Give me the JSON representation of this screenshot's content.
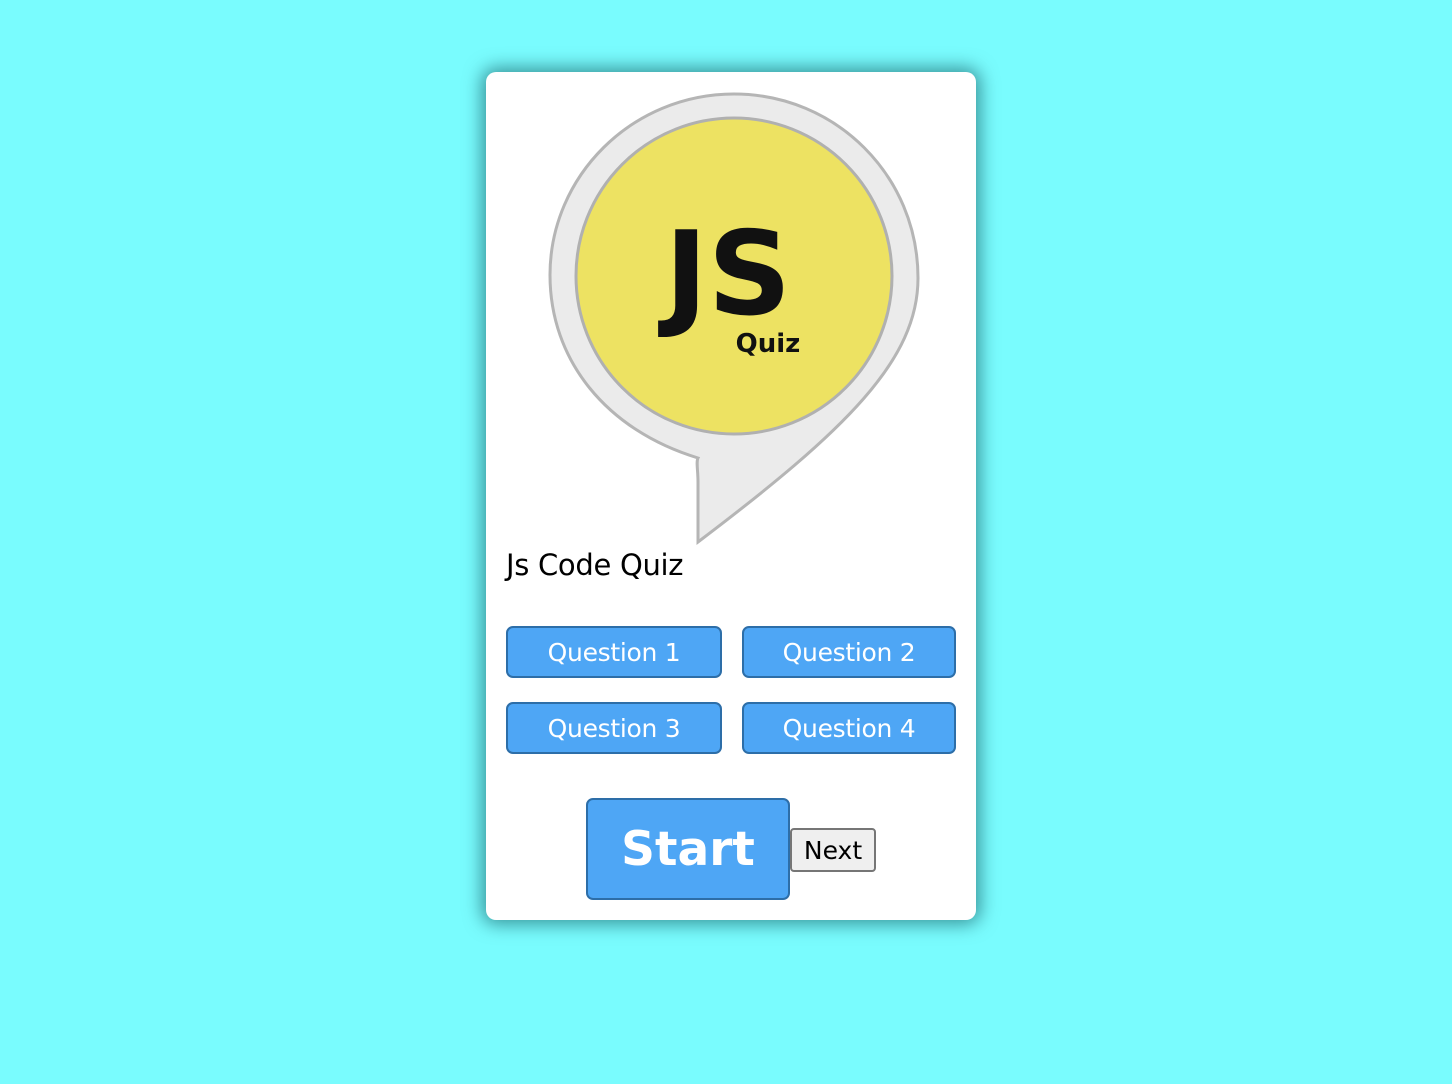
{
  "quiz": {
    "logo_text": "JS",
    "logo_subtext": "Quiz",
    "title": "Js Code Quiz"
  },
  "questions": [
    {
      "label": "Question 1"
    },
    {
      "label": "Question 2"
    },
    {
      "label": "Question 3"
    },
    {
      "label": "Question 4"
    }
  ],
  "controls": {
    "start_label": "Start",
    "next_label": "Next"
  },
  "colors": {
    "background": "#79fcfe",
    "button": "#4ea6f5",
    "logo_yellow": "#ede262"
  },
  "icons": {
    "logo": "speech-bubble-logo-icon"
  }
}
